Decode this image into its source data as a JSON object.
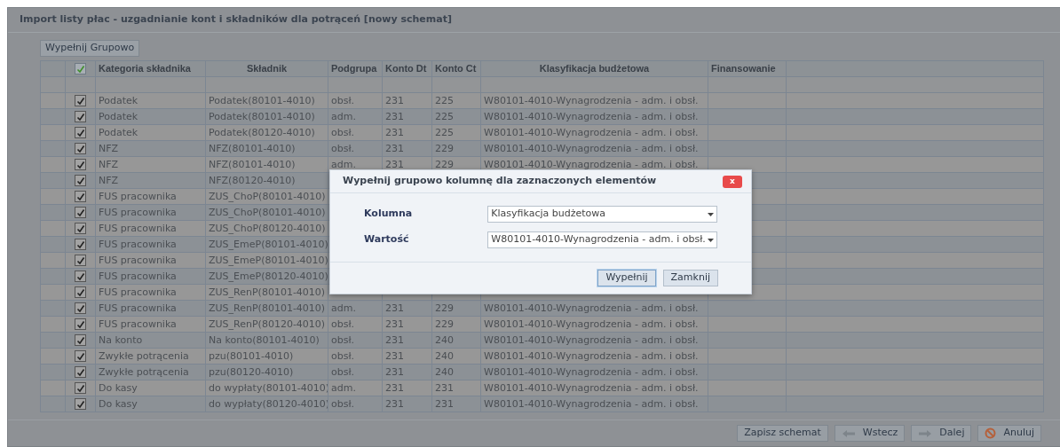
{
  "window": {
    "title": "Import listy płac - uzgadnianie kont i składników dla potrąceń [nowy schemat]"
  },
  "toolbar": {
    "fill_group_button": "Wypełnij Grupowo"
  },
  "table": {
    "header_checked": true,
    "columns": [
      "Kategoria składnika",
      "Składnik",
      "Podgrupa",
      "Konto Dt",
      "Konto Ct",
      "Klasyfikacja budżetowa",
      "Finansowanie"
    ],
    "rows": [
      {
        "checked": true,
        "category": "Podatek",
        "component": "Podatek(80101-4010)",
        "subgroup": "obsł.",
        "dt": "231",
        "ct": "225",
        "classification": "W80101-4010-Wynagrodzenia - adm. i obsł."
      },
      {
        "checked": true,
        "category": "Podatek",
        "component": "Podatek(80101-4010)",
        "subgroup": "adm.",
        "dt": "231",
        "ct": "225",
        "classification": "W80101-4010-Wynagrodzenia - adm. i obsł."
      },
      {
        "checked": true,
        "category": "Podatek",
        "component": "Podatek(80120-4010)",
        "subgroup": "obsł.",
        "dt": "231",
        "ct": "225",
        "classification": "W80101-4010-Wynagrodzenia - adm. i obsł."
      },
      {
        "checked": true,
        "category": "NFZ",
        "component": "NFZ(80101-4010)",
        "subgroup": "obsł.",
        "dt": "231",
        "ct": "229",
        "classification": "W80101-4010-Wynagrodzenia - adm. i obsł."
      },
      {
        "checked": true,
        "category": "NFZ",
        "component": "NFZ(80101-4010)",
        "subgroup": "adm.",
        "dt": "231",
        "ct": "229",
        "classification": "W80101-4010-Wynagrodzenia - adm. i obsł."
      },
      {
        "checked": true,
        "category": "NFZ",
        "component": "NFZ(80120-4010)"
      },
      {
        "checked": true,
        "category": "FUS pracownika",
        "component": "ZUS_ChoP(80101-4010)"
      },
      {
        "checked": true,
        "category": "FUS pracownika",
        "component": "ZUS_ChoP(80101-4010)"
      },
      {
        "checked": true,
        "category": "FUS pracownika",
        "component": "ZUS_ChoP(80120-4010)"
      },
      {
        "checked": true,
        "category": "FUS pracownika",
        "component": "ZUS_EmeP(80101-4010)"
      },
      {
        "checked": true,
        "category": "FUS pracownika",
        "component": "ZUS_EmeP(80101-4010)"
      },
      {
        "checked": true,
        "category": "FUS pracownika",
        "component": "ZUS_EmeP(80120-4010)"
      },
      {
        "checked": true,
        "category": "FUS pracownika",
        "component": "ZUS_RenP(80101-4010)"
      },
      {
        "checked": true,
        "category": "FUS pracownika",
        "component": "ZUS_RenP(80101-4010)",
        "subgroup": "adm.",
        "dt": "231",
        "ct": "229",
        "classification": "W80101-4010-Wynagrodzenia - adm. i obsł."
      },
      {
        "checked": true,
        "category": "FUS pracownika",
        "component": "ZUS_RenP(80120-4010)",
        "subgroup": "obsł.",
        "dt": "231",
        "ct": "229",
        "classification": "W80101-4010-Wynagrodzenia - adm. i obsł."
      },
      {
        "checked": true,
        "category": "Na konto",
        "component": "Na konto(80101-4010)",
        "subgroup": "obsł.",
        "dt": "231",
        "ct": "240",
        "classification": "W80101-4010-Wynagrodzenia - adm. i obsł."
      },
      {
        "checked": true,
        "category": "Zwykłe potrącenia",
        "component": "pzu(80101-4010)",
        "subgroup": "obsł.",
        "dt": "231",
        "ct": "240",
        "classification": "W80101-4010-Wynagrodzenia - adm. i obsł."
      },
      {
        "checked": true,
        "category": "Zwykłe potrącenia",
        "component": "pzu(80120-4010)",
        "subgroup": "obsł.",
        "dt": "231",
        "ct": "240",
        "classification": "W80101-4010-Wynagrodzenia - adm. i obsł."
      },
      {
        "checked": true,
        "category": "Do kasy",
        "component": "do wypłaty(80101-4010)",
        "subgroup": "adm.",
        "dt": "231",
        "ct": "231",
        "classification": "W80101-4010-Wynagrodzenia - adm. i obsł."
      },
      {
        "checked": true,
        "category": "Do kasy",
        "component": "do wypłaty(80120-4010)",
        "subgroup": "obsł.",
        "dt": "231",
        "ct": "231",
        "classification": "W80101-4010-Wynagrodzenia - adm. i obsł."
      }
    ]
  },
  "footer_buttons": [
    {
      "kind": "plain",
      "label": "Zapisz schemat"
    },
    {
      "kind": "back",
      "label": "Wstecz"
    },
    {
      "kind": "next",
      "label": "Dalej"
    },
    {
      "kind": "cancel",
      "label": "Anuluj"
    }
  ],
  "dialog": {
    "title": "Wypełnij grupowo kolumnę dla zaznaczonych elementów",
    "close": "x",
    "fields": [
      {
        "label": "Kolumna",
        "value": "Klasyfikacja budżetowa"
      },
      {
        "label": "Wartość",
        "value": "W80101-4010-Wynagrodzenia - adm. i obsł."
      }
    ],
    "buttons": [
      {
        "label": "Wypełnij",
        "focused": true
      },
      {
        "label": "Zamknij",
        "focused": false
      }
    ]
  }
}
